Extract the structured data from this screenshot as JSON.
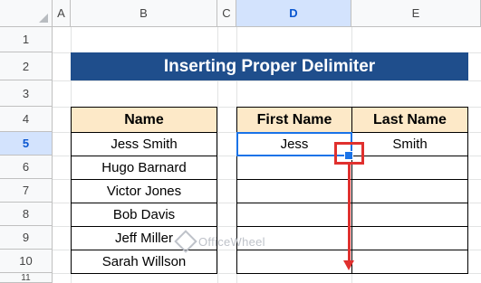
{
  "columns": [
    "A",
    "B",
    "C",
    "D",
    "E"
  ],
  "rows": [
    "1",
    "2",
    "3",
    "4",
    "5",
    "6",
    "7",
    "8",
    "9",
    "10",
    "11"
  ],
  "title": "Inserting Proper Delimiter",
  "name_table": {
    "header": "Name",
    "values": [
      "Jess Smith",
      "Hugo Barnard",
      "Victor Jones",
      "Bob Davis",
      "Jeff Miller",
      "Sarah Willson"
    ]
  },
  "split_table": {
    "headers": [
      "First Name",
      "Last Name"
    ],
    "row5": [
      "Jess",
      "Smith"
    ]
  },
  "watermark": "OfficeWheel",
  "colors": {
    "title_bg": "#1f4e8c",
    "header_bg": "#fde9c8",
    "selection": "#1a73e8",
    "annotation": "#e0302e"
  }
}
